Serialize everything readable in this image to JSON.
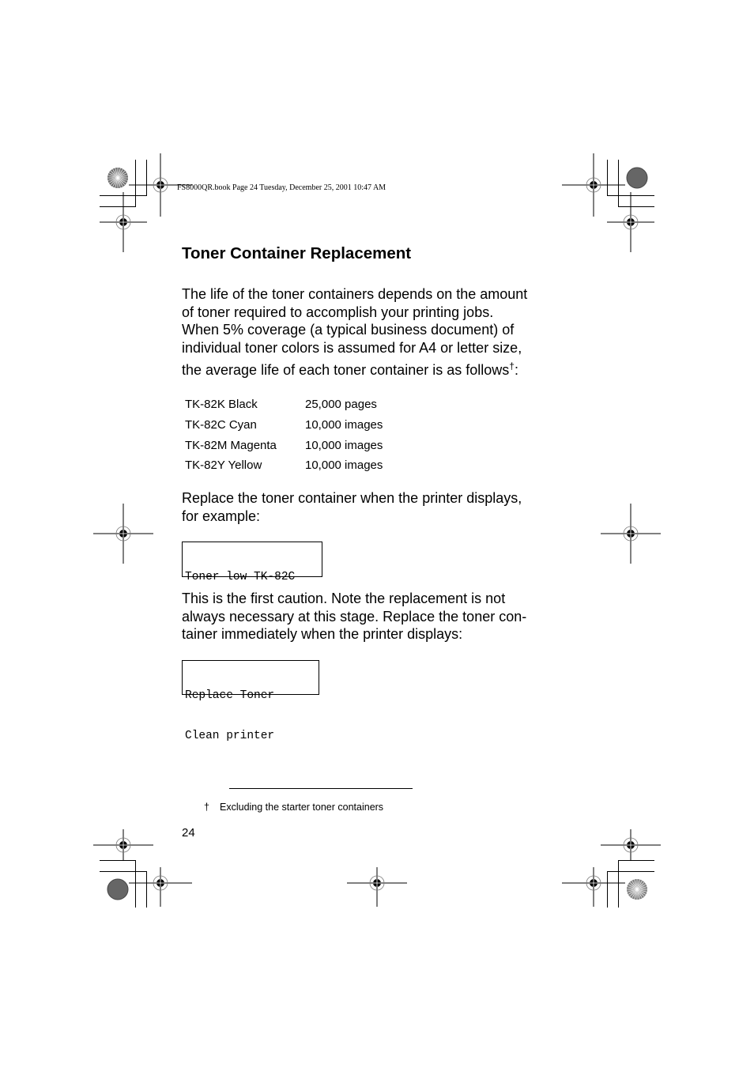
{
  "header": {
    "file_info": "FS8000QR.book  Page 24  Tuesday, December 25, 2001  10:47 AM"
  },
  "section": {
    "title": "Toner Container Replacement",
    "intro_lines": [
      "The life of the toner containers depends on the amount",
      "of toner required to accomplish your printing jobs.",
      "When 5% coverage (a typical business document) of",
      "individual toner colors is assumed for A4 or letter size,",
      "the average life of each toner container is as follows"
    ],
    "intro_dagger": "†",
    "intro_colon": ":",
    "toner_table": [
      {
        "model": "TK-82K Black",
        "life": "25,000 pages"
      },
      {
        "model": "TK-82C Cyan",
        "life": "10,000 images"
      },
      {
        "model": "TK-82M Magenta",
        "life": "10,000 images"
      },
      {
        "model": "TK-82Y Yellow",
        "life": "10,000 images"
      }
    ],
    "replace_lines": [
      "Replace the toner container when the printer displays,",
      "for example:"
    ],
    "display_1": {
      "line1": "Toner low TK-82C",
      "line2": ""
    },
    "caution_lines": [
      "This is the first caution. Note the replacement is not",
      "always necessary at this stage. Replace the toner con-",
      "tainer immediately when the printer displays:"
    ],
    "display_2": {
      "line1": "Replace Toner",
      "line2": "Clean printer"
    }
  },
  "footnote": {
    "symbol": "†",
    "text": "Excluding the starter toner containers"
  },
  "page_number": "24"
}
